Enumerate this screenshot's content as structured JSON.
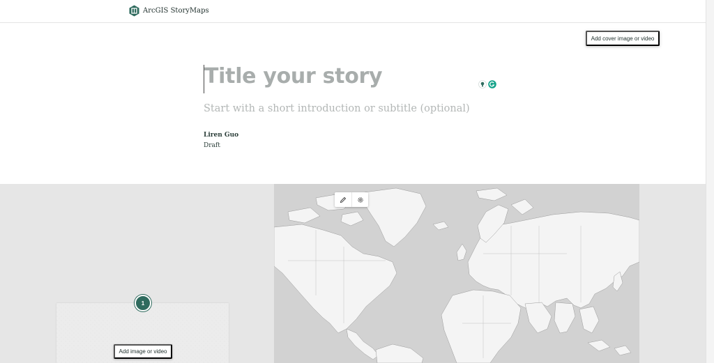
{
  "app": {
    "name": "ArcGIS StoryMaps",
    "logo_icon": "storymaps-logo-icon"
  },
  "cover": {
    "add_cover_label": "Add cover image or video"
  },
  "story": {
    "title_placeholder": "Title your story",
    "subtitle_placeholder": "Start with a short introduction or subtitle (optional)",
    "author": "Liren Guo",
    "status": "Draft"
  },
  "hints": {
    "icons": [
      "lightbulb-icon",
      "grammarly-icon"
    ]
  },
  "map": {
    "tools": [
      "pencil-icon",
      "gear-icon"
    ]
  },
  "slide": {
    "number": "1",
    "add_media_label": "Add image or video"
  },
  "colors": {
    "accent": "#2f6b5e",
    "map_water": "#d2d2d2",
    "map_land": "#f4f4f4"
  }
}
